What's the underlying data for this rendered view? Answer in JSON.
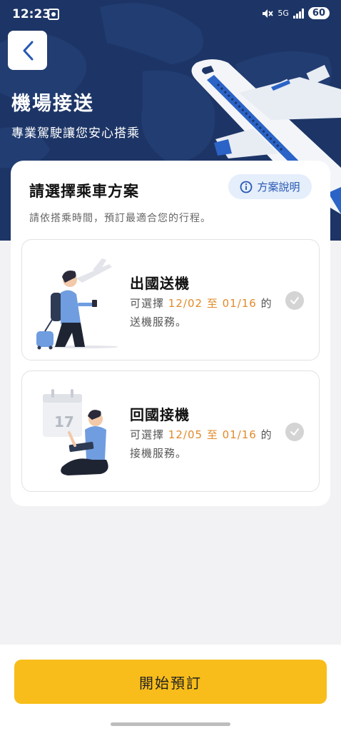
{
  "status_bar": {
    "time": "12:23",
    "network": "5G",
    "battery": "60"
  },
  "header": {
    "title": "機場接送",
    "subtitle": "專業駕駛讓您安心搭乘"
  },
  "card": {
    "title": "請選擇乘車方案",
    "info_button": "方案說明",
    "description": "請依搭乘時間，預訂最適合您的行程。"
  },
  "plans": [
    {
      "name": "出國送機",
      "line1_prefix": "可選擇",
      "start": "12/02",
      "joiner": "至",
      "end": "01/16",
      "line1_suffix": "的",
      "line2": "送機服務。"
    },
    {
      "name": "回國接機",
      "line1_prefix": "可選擇",
      "start": "12/05",
      "joiner": "至",
      "end": "01/16",
      "line1_suffix": "的",
      "line2": "接機服務。",
      "calendar_day": "17"
    }
  ],
  "cta": {
    "label": "開始預訂"
  },
  "colors": {
    "header_bg": "#1d3566",
    "accent_orange": "#e18a2b",
    "cta_yellow": "#f8bd1a",
    "link_blue": "#2657b3"
  }
}
